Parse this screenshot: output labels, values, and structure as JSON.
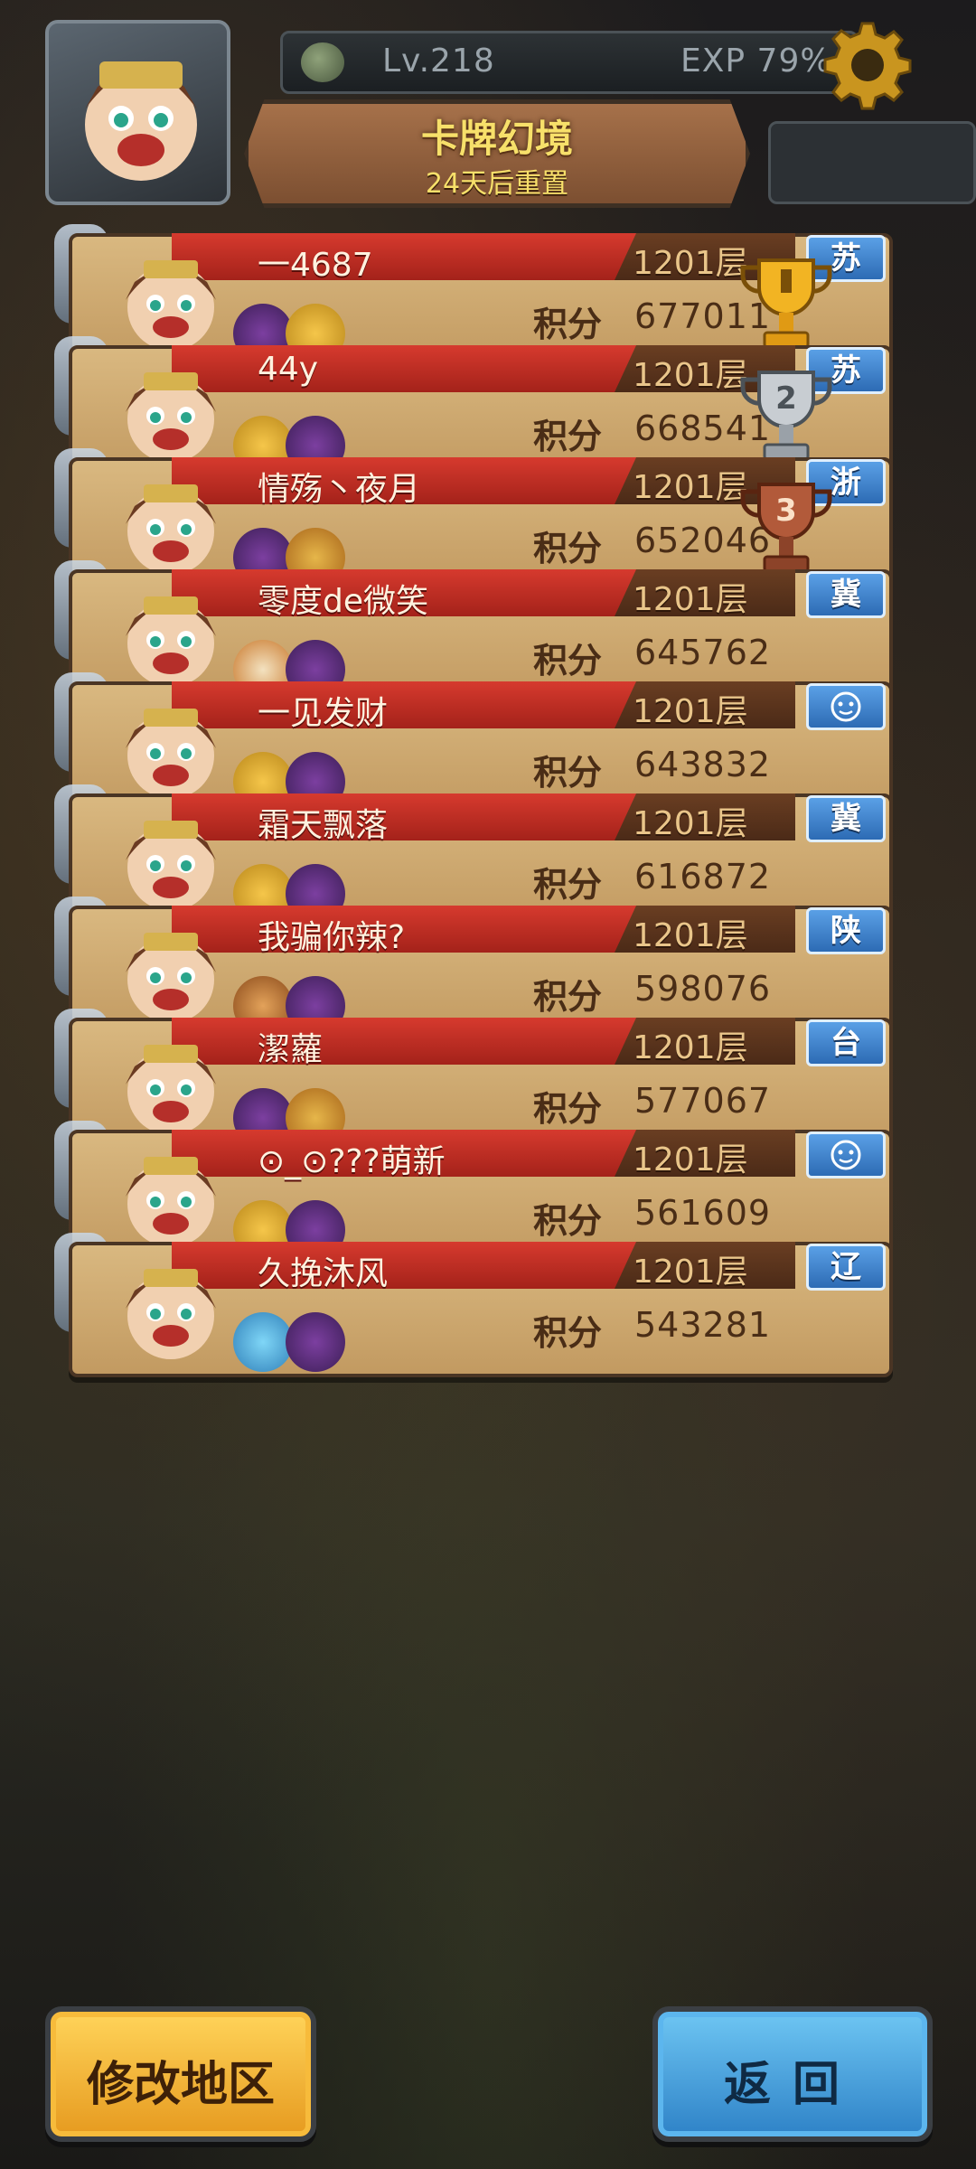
{
  "header": {
    "level": "Lv.218",
    "exp": "EXP  79%",
    "title": "卡牌幻境",
    "subtitle": "24天后重置"
  },
  "labels": {
    "score": "积分"
  },
  "rows": [
    {
      "name": "一4687",
      "floor": "1201层",
      "region": "苏",
      "score": "677011",
      "trophy": "gold"
    },
    {
      "name": "44y",
      "floor": "1201层",
      "region": "苏",
      "score": "668541",
      "trophy": "silver"
    },
    {
      "name": "情殇丶夜月",
      "floor": "1201层",
      "region": "浙",
      "score": "652046",
      "trophy": "bronze"
    },
    {
      "name": "零度de微笑",
      "floor": "1201层",
      "region": "冀",
      "score": "645762"
    },
    {
      "name": "一见发财",
      "floor": "1201层",
      "region": "",
      "region_icon": "face-icon",
      "score": "643832"
    },
    {
      "name": "霜天飘落",
      "floor": "1201层",
      "region": "冀",
      "score": "616872"
    },
    {
      "name": "我骗你辣?",
      "floor": "1201层",
      "region": "陕",
      "score": "598076"
    },
    {
      "name": "潔蘿",
      "floor": "1201层",
      "region": "台",
      "score": "577067"
    },
    {
      "name": "⊙_⊙???萌新",
      "floor": "1201层",
      "region": "",
      "region_icon": "face-icon",
      "score": "561609"
    },
    {
      "name": "久挽沐风",
      "floor": "1201层",
      "region": "辽",
      "score": "543281"
    }
  ],
  "buttons": {
    "change_region": "修改地区",
    "back": "返回"
  },
  "colors": {
    "band_red": "#c72e25",
    "card_tan": "#d0ab72",
    "badge_blue": "#3a7fd0",
    "gold": "#f2b423",
    "silver": "#c8cdd2",
    "bronze": "#b25a3a"
  }
}
